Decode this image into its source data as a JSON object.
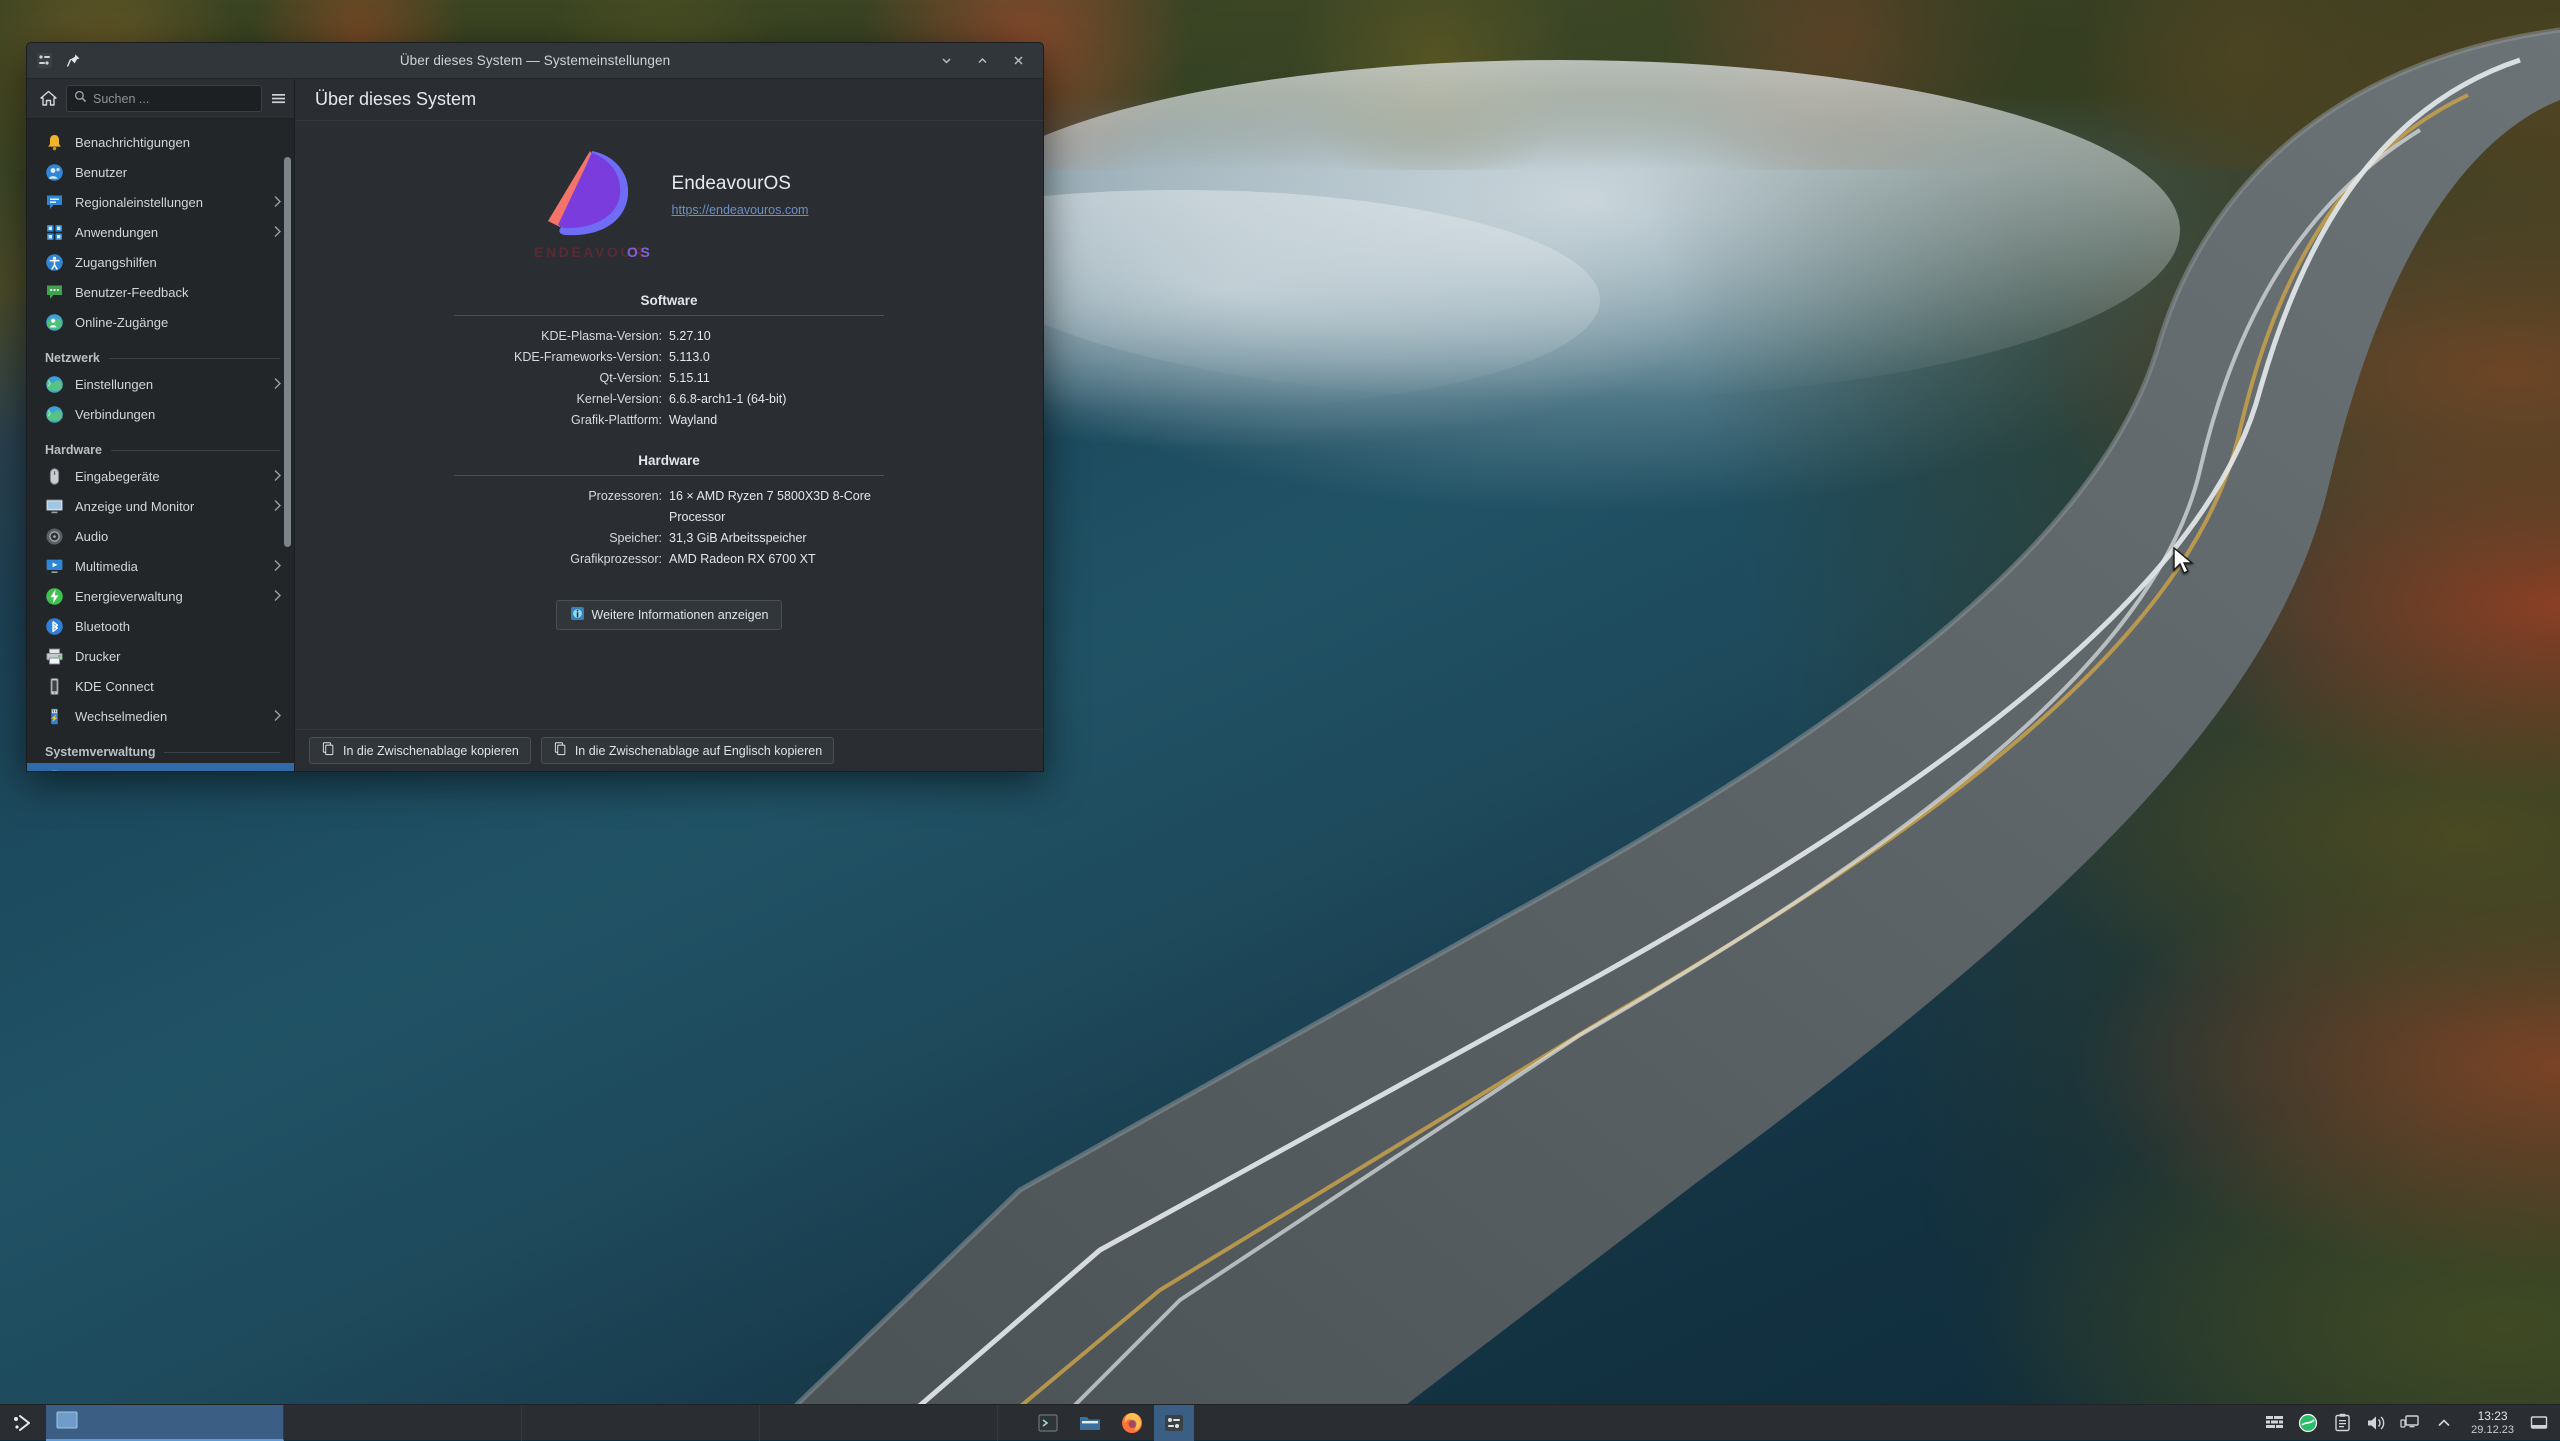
{
  "window": {
    "title": "Über dieses System — Systemeinstellungen",
    "titlebar_icons": {
      "app": "settings-icon",
      "pin": "pin-icon"
    },
    "controls": {
      "minimize": "⌄",
      "maximize": "⌃",
      "close": "✕"
    }
  },
  "sidebar": {
    "home_icon": "home-icon",
    "menu_icon": "hamburger-icon",
    "search": {
      "placeholder": "Suchen ...",
      "value": "",
      "icon": "search-icon"
    },
    "groups": [
      {
        "header": "",
        "items": [
          {
            "label": "Benachrichtigungen",
            "icon": "bell-icon",
            "arrow": false,
            "selected": false
          },
          {
            "label": "Benutzer",
            "icon": "users-icon",
            "arrow": false,
            "selected": false
          },
          {
            "label": "Regionaleinstellungen",
            "icon": "locale-icon",
            "arrow": true,
            "selected": false
          },
          {
            "label": "Anwendungen",
            "icon": "apps-icon",
            "arrow": true,
            "selected": false
          },
          {
            "label": "Zugangshilfen",
            "icon": "accessibility-icon",
            "arrow": false,
            "selected": false
          },
          {
            "label": "Benutzer-Feedback",
            "icon": "feedback-icon",
            "arrow": false,
            "selected": false
          },
          {
            "label": "Online-Zugänge",
            "icon": "online-accounts-icon",
            "arrow": false,
            "selected": false
          }
        ]
      },
      {
        "header": "Netzwerk",
        "items": [
          {
            "label": "Einstellungen",
            "icon": "globe-icon",
            "arrow": true,
            "selected": false
          },
          {
            "label": "Verbindungen",
            "icon": "globe-icon",
            "arrow": false,
            "selected": false
          }
        ]
      },
      {
        "header": "Hardware",
        "items": [
          {
            "label": "Eingabegeräte",
            "icon": "mouse-icon",
            "arrow": true,
            "selected": false
          },
          {
            "label": "Anzeige und Monitor",
            "icon": "display-icon",
            "arrow": true,
            "selected": false
          },
          {
            "label": "Audio",
            "icon": "audio-icon",
            "arrow": false,
            "selected": false
          },
          {
            "label": "Multimedia",
            "icon": "multimedia-icon",
            "arrow": true,
            "selected": false
          },
          {
            "label": "Energieverwaltung",
            "icon": "power-icon",
            "arrow": true,
            "selected": false
          },
          {
            "label": "Bluetooth",
            "icon": "bluetooth-icon",
            "arrow": false,
            "selected": false
          },
          {
            "label": "Drucker",
            "icon": "printer-icon",
            "arrow": false,
            "selected": false
          },
          {
            "label": "KDE Connect",
            "icon": "kdeconnect-icon",
            "arrow": false,
            "selected": false
          },
          {
            "label": "Wechselmedien",
            "icon": "usb-icon",
            "arrow": true,
            "selected": false
          }
        ]
      },
      {
        "header": "Systemverwaltung",
        "items": [
          {
            "label": "",
            "icon": "about-icon",
            "arrow": false,
            "selected": true
          }
        ]
      }
    ]
  },
  "page": {
    "title": "Über dieses System",
    "os_name": "EndeavourOS",
    "os_url": "https://endeavouros.com",
    "logo_wordmark": "ENDEAVOUR OS",
    "sections": [
      {
        "title": "Software",
        "rows": [
          {
            "key": "KDE-Plasma-Version:",
            "value": "5.27.10"
          },
          {
            "key": "KDE-Frameworks-Version:",
            "value": "5.113.0"
          },
          {
            "key": "Qt-Version:",
            "value": "5.15.11"
          },
          {
            "key": "Kernel-Version:",
            "value": "6.6.8-arch1-1 (64-bit)"
          },
          {
            "key": "Grafik-Plattform:",
            "value": "Wayland"
          }
        ]
      },
      {
        "title": "Hardware",
        "rows": [
          {
            "key": "Prozessoren:",
            "value": "16 × AMD Ryzen 7 5800X3D 8-Core Processor"
          },
          {
            "key": "Speicher:",
            "value": "31,3 GiB Arbeitsspeicher"
          },
          {
            "key": "Grafikprozessor:",
            "value": "AMD Radeon RX 6700 XT"
          }
        ]
      }
    ],
    "more_button": {
      "label": "Weitere Informationen anzeigen",
      "icon": "info-icon"
    }
  },
  "footer": {
    "buttons": [
      {
        "label": "In die Zwischenablage kopieren",
        "icon": "copy-icon"
      },
      {
        "label": "In die Zwischenablage auf Englisch kopieren",
        "icon": "copy-icon"
      }
    ]
  },
  "taskbar": {
    "launcher_icon": "endeavouros-launcher-icon",
    "tasks": [
      {
        "label": "",
        "icon": "window-icon",
        "active": true
      },
      {
        "label": "",
        "icon": "window-icon",
        "active": false
      },
      {
        "label": "",
        "icon": "window-icon",
        "active": false
      },
      {
        "label": "",
        "icon": "window-icon",
        "active": false
      }
    ],
    "pinned": [
      {
        "name": "terminal-icon",
        "active": false
      },
      {
        "name": "file-manager-icon",
        "active": false
      },
      {
        "name": "firefox-icon",
        "active": false
      },
      {
        "name": "system-settings-icon",
        "active": true
      }
    ],
    "tray": [
      {
        "name": "firewall-icon"
      },
      {
        "name": "network-icon"
      },
      {
        "name": "clipboard-icon"
      },
      {
        "name": "volume-icon"
      },
      {
        "name": "display-config-icon"
      },
      {
        "name": "show-hidden-chevron-icon"
      }
    ],
    "clock": {
      "time": "13:23",
      "date": "29.12.23"
    },
    "show_desktop_icon": "show-desktop-icon"
  },
  "colors": {
    "accent": "#2f6ba8",
    "window_bg": "#2a2e32",
    "sidebar_bg": "#222629",
    "titlebar_bg": "#31363b",
    "link": "#6d8fc4",
    "logo_purple": "#7a3cdd",
    "logo_blue": "#6f6cf5",
    "logo_salmon": "#f4736a"
  }
}
